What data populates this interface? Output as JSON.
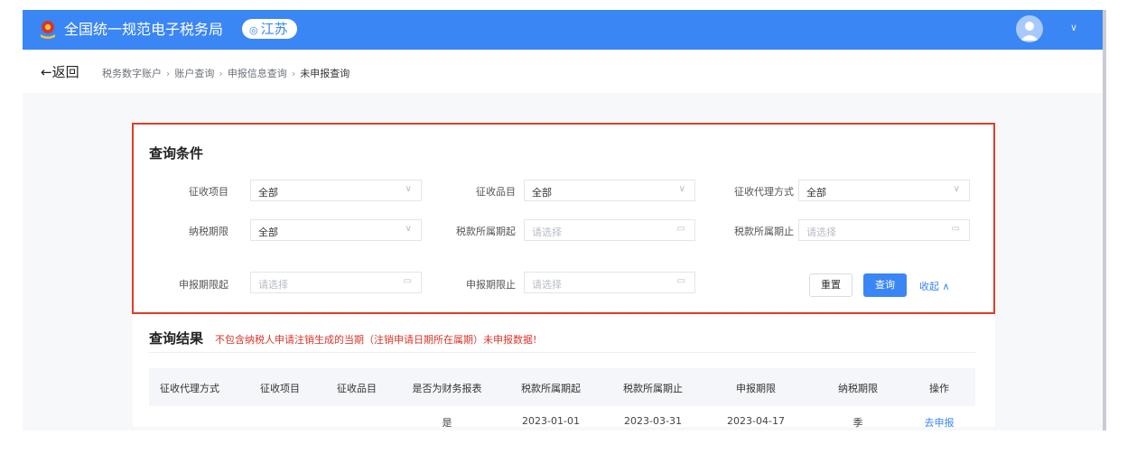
{
  "header": {
    "title": "全国统一规范电子税务局",
    "region": "江苏",
    "colors": {
      "brand": "#3a86f5",
      "highlight": "#e03c2b",
      "notice": "#d8362a"
    }
  },
  "breadcrumb": {
    "back": "←返回",
    "items": [
      "税务数字账户",
      "账户查询",
      "申报信息查询",
      "未申报查询"
    ]
  },
  "query": {
    "title": "查询条件",
    "fields": [
      {
        "label": "征收项目",
        "value": "全部",
        "kind": "select"
      },
      {
        "label": "征收品目",
        "value": "全部",
        "kind": "select"
      },
      {
        "label": "征收代理方式",
        "value": "全部",
        "kind": "select"
      },
      {
        "label": "纳税期限",
        "value": "全部",
        "kind": "select"
      },
      {
        "label": "税款所属期起",
        "placeholder": "请选择",
        "kind": "date"
      },
      {
        "label": "税款所属期止",
        "placeholder": "请选择",
        "kind": "date"
      },
      {
        "label": "申报期限起",
        "placeholder": "请选择",
        "kind": "date"
      },
      {
        "label": "申报期限止",
        "placeholder": "请选择",
        "kind": "date"
      }
    ],
    "reset_label": "重置",
    "query_label": "查询",
    "collapse_label": "收起 ∧"
  },
  "results": {
    "title": "查询结果",
    "notice": "不包含纳税人申请注销生成的当期（注销申请日期所在属期）未申报数据!",
    "columns": [
      "征收代理方式",
      "征收项目",
      "征收品目",
      "是否为财务报表",
      "税款所属期起",
      "税款所属期止",
      "申报期限",
      "纳税期限",
      "操作"
    ],
    "rows": [
      [
        "",
        "",
        "",
        "是",
        "2023-01-01",
        "2023-03-31",
        "2023-04-17",
        "季",
        "去申报"
      ]
    ]
  }
}
